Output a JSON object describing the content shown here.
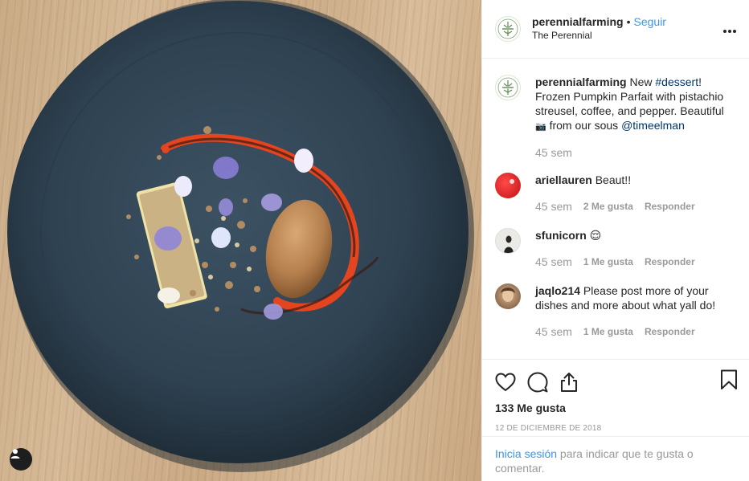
{
  "post": {
    "account": {
      "username": "perennialfarming",
      "follow_label": "Seguir",
      "location": "The Perennial",
      "logo_icon": "perennial-farming-logo"
    },
    "more_icon": "more-options-icon",
    "caption": {
      "username": "perennialfarming",
      "text_before": "New ",
      "hashtag": "#dessert",
      "text_after": "! Frozen Pumpkin Parfait with pistachio streusel, coffee, and pepper. Beautiful",
      "camera_glyph": "📷",
      "text_credit": " from our sous ",
      "mention": "@timeelman",
      "time": "45 sem"
    },
    "comments": [
      {
        "username": "ariellauren",
        "text": "Beaut!!",
        "time": "45 sem",
        "likes": "2 Me gusta",
        "reply": "Responder",
        "avatar_color": "#d81f1f"
      },
      {
        "username": "sfunicorn",
        "text": "😌",
        "time": "45 sem",
        "likes": "1 Me gusta",
        "reply": "Responder",
        "avatar_color": "#e8e4df"
      },
      {
        "username": "jaqlo214",
        "text": "Please post more of your dishes and more about what yall do!",
        "time": "45 sem",
        "likes": "1 Me gusta",
        "reply": "Responder",
        "avatar_color": "#8a6a4f"
      }
    ],
    "like_count": "133 Me gusta",
    "date": "12 DE DICIEMBRE DE 2018",
    "login_prompt": {
      "link": "Inicia sesión",
      "rest": " para indicar que te gusta o comentar."
    },
    "icons": {
      "like": "heart-icon",
      "comment": "comment-bubble-icon",
      "share": "share-icon",
      "save": "bookmark-icon",
      "user": "user-icon"
    }
  }
}
